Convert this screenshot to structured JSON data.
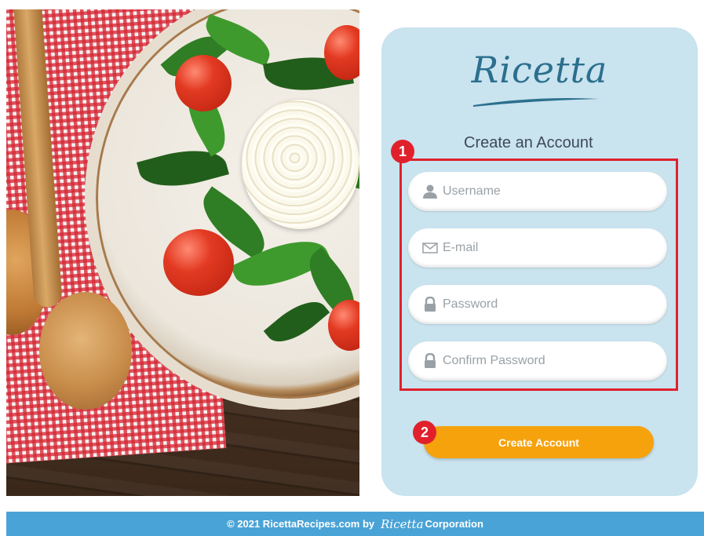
{
  "brand": {
    "logo_text": "Ricetta",
    "color": "#2b6f8e"
  },
  "form": {
    "heading": "Create an Account",
    "fields": [
      {
        "placeholder": "Username",
        "icon": "user-icon"
      },
      {
        "placeholder": "E-mail",
        "icon": "mail-icon"
      },
      {
        "placeholder": "Password",
        "icon": "lock-icon"
      },
      {
        "placeholder": "Confirm Password",
        "icon": "lock-icon"
      }
    ],
    "submit_label": "Create Account",
    "submit_color": "#f6a20c"
  },
  "annotations": {
    "badge_1": "1",
    "badge_2": "2",
    "color": "#e0212c"
  },
  "footer": {
    "text_prefix": "© 2021 RicettaRecipes.com by",
    "mini_logo": "Ricetta",
    "text_suffix": "Corporation",
    "background": "#4aa3d6"
  },
  "hero_image": {
    "subject": "salad-plate-photo"
  }
}
